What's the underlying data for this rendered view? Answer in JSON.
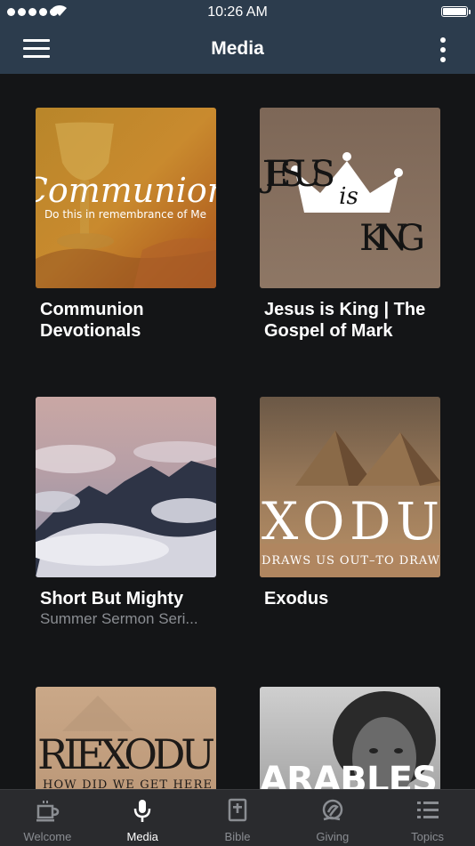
{
  "status_bar": {
    "time": "10:26 AM"
  },
  "header": {
    "title": "Media"
  },
  "icons": {
    "menu": "hamburger-menu-icon",
    "more": "vertical-dots-icon"
  },
  "media_items": [
    {
      "title": "Communion Devotionals",
      "subtitle": "",
      "art_text": [
        "Communion",
        "Do this in remembrance of Me"
      ]
    },
    {
      "title": "Jesus is King | The Gospel of Mark",
      "subtitle": "",
      "art_text": [
        "JESUS",
        "is",
        "KING"
      ]
    },
    {
      "title": "Short But Mighty",
      "subtitle": "Summer Sermon Seri...",
      "art_text": []
    },
    {
      "title": "Exodus",
      "subtitle": "",
      "art_text": [
        "XODU",
        "DRAWS US OUT–TO DRAW"
      ]
    },
    {
      "title": "",
      "subtitle": "",
      "art_text": [
        "RIEXODU",
        "HOW DID WE GET HERE"
      ]
    },
    {
      "title": "",
      "subtitle": "",
      "art_text": [
        "ARABLES"
      ]
    }
  ],
  "tabs": [
    {
      "label": "Welcome",
      "icon": "coffee-cup-icon",
      "active": false
    },
    {
      "label": "Media",
      "icon": "microphone-icon",
      "active": true
    },
    {
      "label": "Bible",
      "icon": "bible-icon",
      "active": false
    },
    {
      "label": "Giving",
      "icon": "giving-icon",
      "active": false
    },
    {
      "label": "Topics",
      "icon": "list-icon",
      "active": false
    }
  ],
  "colors": {
    "header_bg": "#2c3c4d",
    "background": "#141517",
    "tabbar_bg": "#2a2b2e",
    "tab_inactive": "#8a8d92",
    "tab_active": "#ffffff"
  }
}
